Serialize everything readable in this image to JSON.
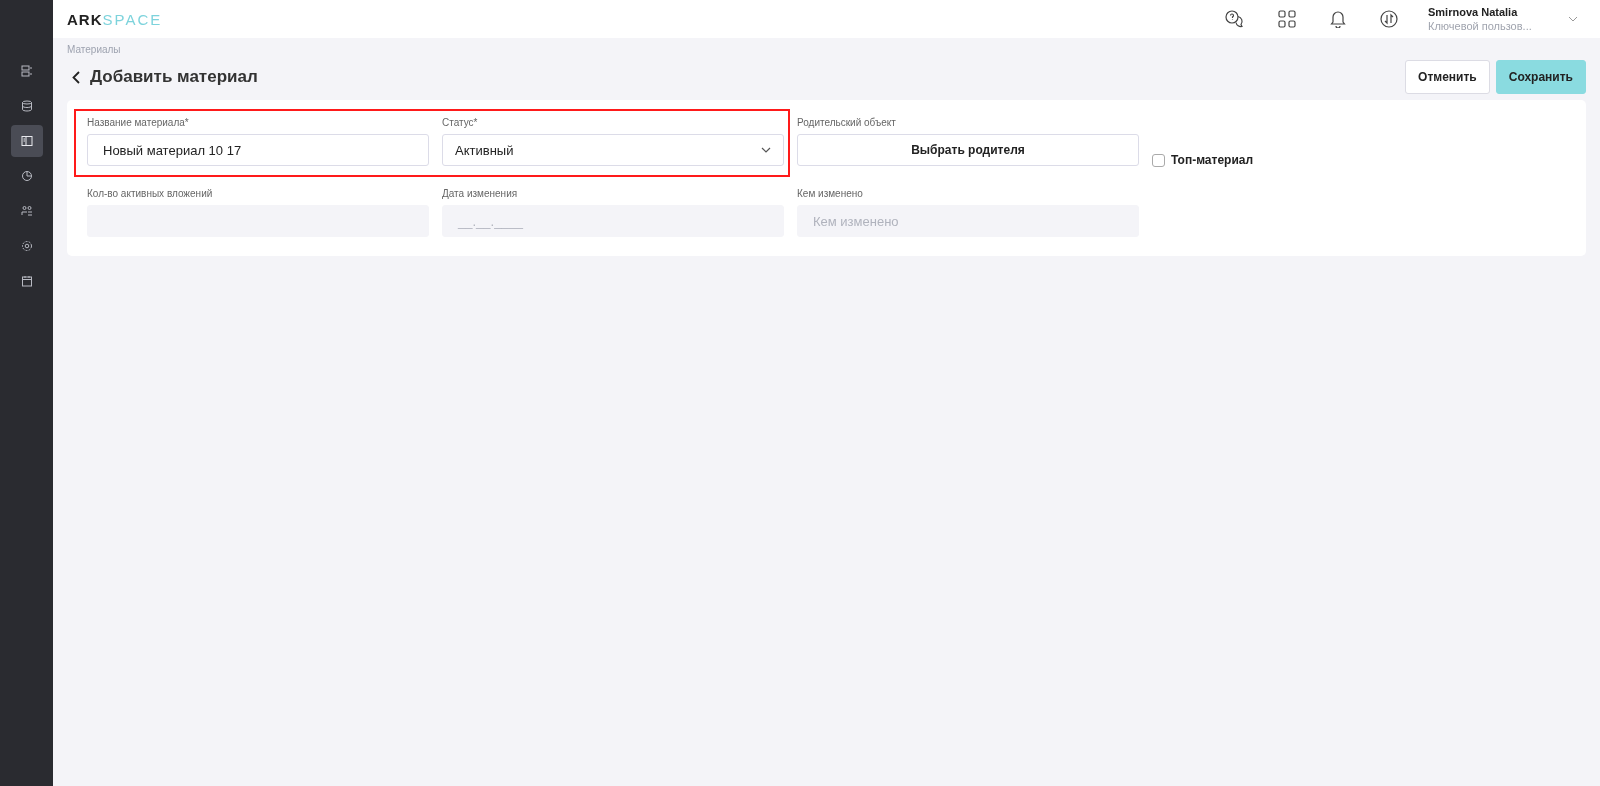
{
  "logo": {
    "part_1": "ARK",
    "part_2": "SPACE"
  },
  "sidebar": {
    "items": [
      {
        "kind": "list",
        "selected": false
      },
      {
        "kind": "database",
        "selected": false
      },
      {
        "kind": "book",
        "selected": true
      },
      {
        "kind": "chart",
        "selected": false
      },
      {
        "kind": "users",
        "selected": false
      },
      {
        "kind": "settings",
        "selected": false
      },
      {
        "kind": "calendar",
        "selected": false
      }
    ]
  },
  "header": {
    "user_name": "Smirnova Natalia",
    "user_role": "Ключевой пользов..."
  },
  "breadcrumb": "Материалы",
  "page_title": "Добавить материал",
  "buttons": {
    "cancel": "Отменить",
    "save": "Сохранить"
  },
  "form": {
    "highlight": true,
    "name": {
      "label": "Название материала*",
      "value": "Новый материал 10 17"
    },
    "status": {
      "label": "Статус*",
      "value": "Активный"
    },
    "parent": {
      "label": "Родительский объект",
      "button": "Выбрать родителя"
    },
    "top_material": {
      "label": "Топ-материал",
      "checked": false
    },
    "attachments": {
      "label": "Кол-во активных вложений"
    },
    "changed_date": {
      "label": "Дата изменения",
      "placeholder": "__.__.____"
    },
    "changed_by": {
      "label": "Кем изменено",
      "placeholder": "Кем изменено"
    }
  }
}
